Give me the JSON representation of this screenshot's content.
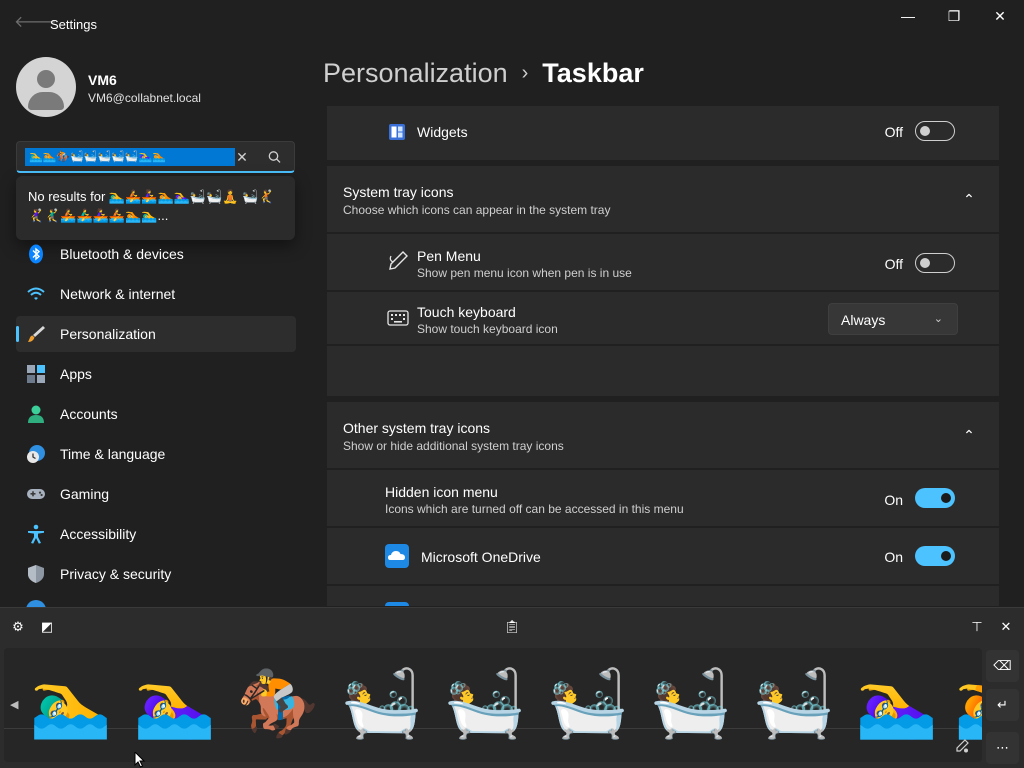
{
  "app": {
    "title": "Settings"
  },
  "window_controls": {
    "minimize": "—",
    "restore": "❐",
    "close": "✕"
  },
  "user": {
    "name": "VM6",
    "email": "VM6@collabnet.local"
  },
  "search": {
    "value": "🏊‍♂️🏊🏇🛀🛀🛀🛀🛀🏊‍♀️🏊",
    "no_results": "No results for 🏊‍♂️🚣🚣‍♀️🏊🏊‍♀️🛀🛀🧘 🛀🤾🤾‍♀️🤾‍♂️🚣🚣‍♂️🚣‍♀️🚣🏊🏊‍♂️..."
  },
  "nav": [
    {
      "label": "Bluetooth & devices",
      "icon": "bluetooth-icon",
      "active": false
    },
    {
      "label": "Network & internet",
      "icon": "wifi-icon",
      "active": false
    },
    {
      "label": "Personalization",
      "icon": "brush-icon",
      "active": true
    },
    {
      "label": "Apps",
      "icon": "apps-icon",
      "active": false
    },
    {
      "label": "Accounts",
      "icon": "accounts-icon",
      "active": false
    },
    {
      "label": "Time & language",
      "icon": "clock-globe-icon",
      "active": false
    },
    {
      "label": "Gaming",
      "icon": "gamepad-icon",
      "active": false
    },
    {
      "label": "Accessibility",
      "icon": "accessibility-icon",
      "active": false
    },
    {
      "label": "Privacy & security",
      "icon": "shield-icon",
      "active": false
    }
  ],
  "breadcrumb": {
    "parent": "Personalization",
    "separator": "›",
    "current": "Taskbar"
  },
  "widgets": {
    "label": "Widgets",
    "state": "Off"
  },
  "system_tray": {
    "title": "System tray icons",
    "subtitle": "Choose which icons can appear in the system tray",
    "pen_menu": {
      "title": "Pen Menu",
      "subtitle": "Show pen menu icon when pen is in use",
      "state": "Off"
    },
    "touch_keyboard": {
      "title": "Touch keyboard",
      "subtitle": "Show touch keyboard icon",
      "selected": "Always"
    }
  },
  "other_tray": {
    "title": "Other system tray icons",
    "subtitle": "Show or hide additional system tray icons",
    "hidden_menu": {
      "title": "Hidden icon menu",
      "subtitle": "Icons which are turned off can be accessed in this menu",
      "state": "On"
    },
    "onedrive": {
      "title": "Microsoft OneDrive",
      "state": "On"
    }
  },
  "emoji_panel": {
    "emojis": [
      "🏊‍♂️",
      "🏊‍♀️",
      "🏇",
      "🛀",
      "🛀",
      "🛀",
      "🛀",
      "🛀",
      "🏊‍♀️",
      "🏊"
    ]
  },
  "colors": {
    "accent": "#4cc2ff",
    "selection": "#0078d4",
    "background": "#202020",
    "card": "#2b2b2b"
  }
}
